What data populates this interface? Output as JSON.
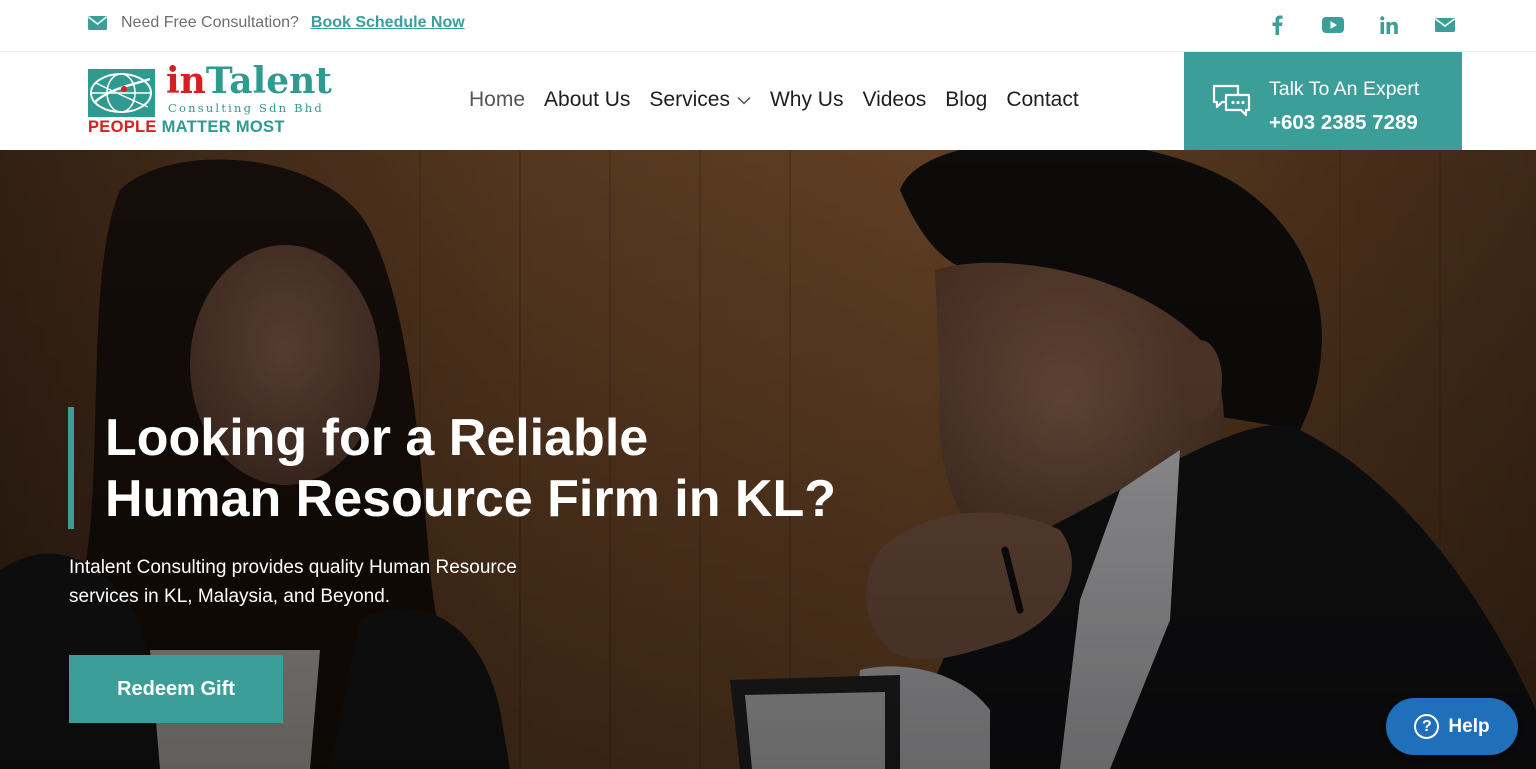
{
  "topbar": {
    "consult_text": "Need Free Consultation?",
    "book_link": "Book Schedule Now",
    "socials": [
      "facebook-icon",
      "youtube-icon",
      "linkedin-icon",
      "mail-icon"
    ]
  },
  "logo": {
    "brand_in": "in",
    "brand_talent": "Talent",
    "subtitle": "Consulting Sdn Bhd",
    "tagline_red": "PEOPLE",
    "tagline_teal": "MATTER MOST"
  },
  "nav": {
    "items": [
      {
        "label": "Home",
        "active": true
      },
      {
        "label": "About Us"
      },
      {
        "label": "Services",
        "has_dropdown": true
      },
      {
        "label": "Why Us"
      },
      {
        "label": "Videos"
      },
      {
        "label": "Blog"
      },
      {
        "label": "Contact"
      }
    ]
  },
  "expert": {
    "label": "Talk To An Expert",
    "phone": "+603 2385 7289"
  },
  "hero": {
    "title_line1": "Looking for a Reliable",
    "title_line2": "Human Resource Firm in KL?",
    "description": "Intalent Consulting provides quality Human Resource services in KL, Malaysia, and Beyond.",
    "cta": "Redeem Gift"
  },
  "help": {
    "label": "Help"
  },
  "colors": {
    "accent": "#3b9e99",
    "brand_red": "#d42020",
    "help_blue": "#1f6fba"
  }
}
